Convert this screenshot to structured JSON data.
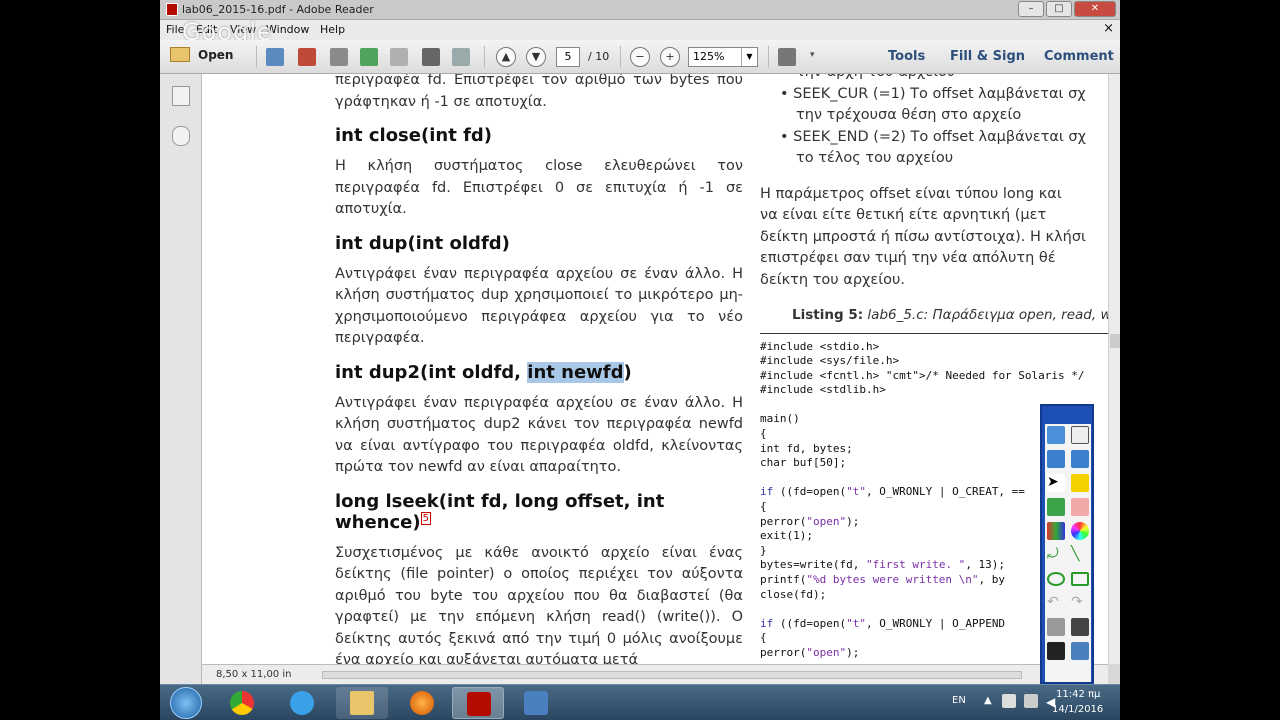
{
  "window": {
    "title": "lab06_2015-16.pdf - Adobe Reader",
    "min": "–",
    "max": "□",
    "close": "✕"
  },
  "menu": {
    "items": [
      "File",
      "Edit",
      "View",
      "Window",
      "Help"
    ],
    "close": "×",
    "overlay": "Google"
  },
  "toolbar": {
    "open_label": "Open",
    "page_current": "5",
    "page_total": "/ 10",
    "zoom_value": "125%",
    "tools": "Tools",
    "fill_sign": "Fill & Sign",
    "comment": "Comment"
  },
  "doc": {
    "left": {
      "p0": "περιγραφέα fd. Επιστρέφει τον αριθμό των bytes που γράφτηκαν ή -1 σε αποτυχία.",
      "h_close": "int close(int fd)",
      "p_close": "Η κλήση συστήματος close ελευθερώνει τον περιγραφέα fd. Επιστρέφει 0 σε επιτυχία ή -1 σε αποτυχία.",
      "h_dup": "int dup(int oldfd)",
      "p_dup": "Αντιγράφει έναν περιγραφέα αρχείου σε έναν άλλο. Η κλήση συστήματος dup χρησιμοποιεί το μικρότερο μη-χρησιμοποιούμενο περιγράφεα αρχείου για το νέο περιγραφέα.",
      "h_dup2_a": "int dup2(int oldfd, ",
      "h_dup2_b": "int newfd",
      "h_dup2_c": ")",
      "p_dup2": "Αντιγράφει έναν περιγραφέα αρχείου σε έναν άλλο. Η κλήση συστήματος dup2 κάνει τον περιγραφέα newfd να είναι αντίγραφο του περιγραφέα oldfd, κλείνοντας πρώτα τον newfd αν είναι απαραίτητο.",
      "h_lseek": "long lseek(int fd, long offset, int whence)",
      "h_lseek_sup": "5",
      "p_lseek": "Συσχετισμένος με κάθε ανοικτό αρχείο είναι ένας δείκτης (file pointer) ο οποίος περιέχει τον αύξοντα αριθμό του byte του αρχείου που θα διαβαστεί (θα γραφτεί) με την επόμενη κλήση read() (write()). Ο δείκτης αυτός ξεκινά από την τιμή 0 μόλις ανοίξουμε ένα αρχείο και αυξάνεται αυτόματα μετά"
    },
    "right": {
      "b0": "την αρχή του αρχείου",
      "b1": "SEEK_CUR (=1) Το offset λαμβάνεται σχ",
      "b1b": "την τρέχουσα θέση στο αρχείο",
      "b2": "SEEK_END (=2) Το offset λαμβάνεται σχ",
      "b2b": "το τέλος του αρχείου",
      "p1": "Η παράμετρος offset είναι τύπου long και",
      "p2": "να είναι είτε θετική είτε αρνητική (μετ",
      "p3": "δείκτη μπροστά ή πίσω αντίστοιχα). Η κλήσι",
      "p4": "επιστρέφει σαν τιμή την νέα απόλυτη θέ",
      "p5": "δείκτη του αρχείου.",
      "listing_bold": "Listing 5:",
      "listing_rest": " lab6_5.c: Παράδειγμα open, read, w",
      "code": [
        "#include <stdio.h>",
        "#include <sys/file.h>",
        "#include <fcntl.h> /* Needed for Solaris */",
        "#include <stdlib.h>",
        "",
        "main()",
        "{",
        "int fd, bytes;",
        "char buf[50];",
        "",
        "if ((fd=open(\"t\", O_WRONLY | O_CREAT, ==",
        "{",
        "perror(\"open\");",
        "exit(1);",
        "}",
        "bytes=write(fd, \"first write. \", 13);",
        "printf(\"%d bytes were written \\n\", by",
        "close(fd);",
        "",
        "if ((fd=open(\"t\", O_WRONLY | O_APPEND",
        "{",
        "perror(\"open\");"
      ]
    }
  },
  "status": {
    "page_size": "8,50 x 11,00 in"
  },
  "taskbar": {
    "lang": "EN",
    "time": "11:42 πμ",
    "date": "14/1/2016"
  },
  "colors": {
    "highlight": "#a9c8e8",
    "accent": "#2c4f7c",
    "pdf_red": "#b30b00"
  }
}
